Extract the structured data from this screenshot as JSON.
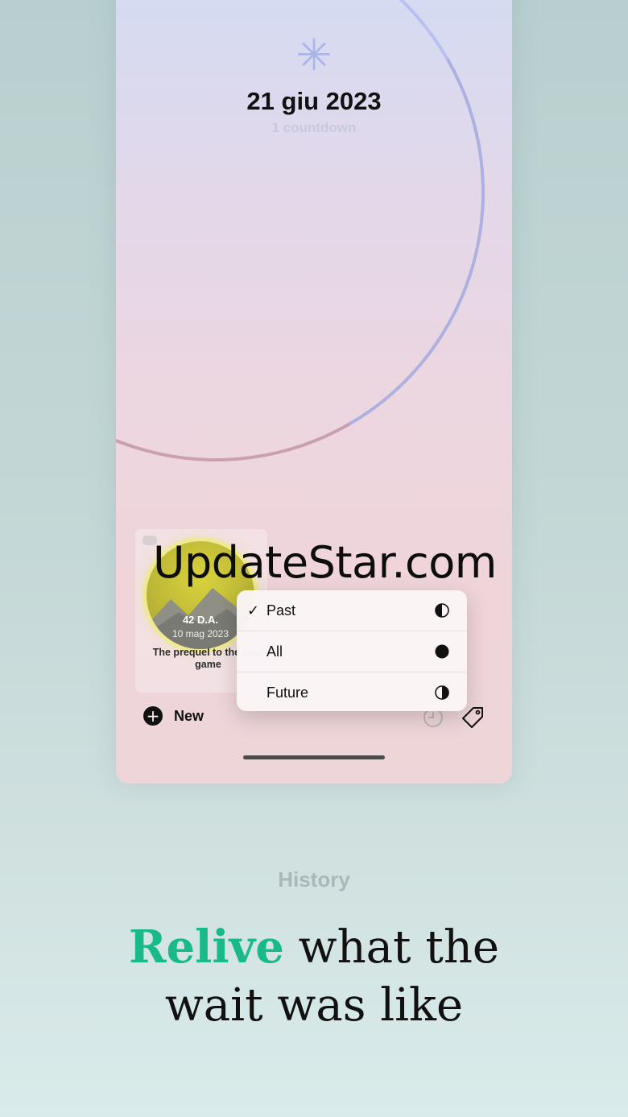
{
  "header": {
    "date_title": "21 giu 2023",
    "subtitle": "1 countdown"
  },
  "card": {
    "days": "42 D.A.",
    "date": "10 mag 2023",
    "title": "The prequel to the cool game"
  },
  "watermark": "UpdateStar.com",
  "filter_menu": {
    "items": [
      {
        "label": "Past",
        "checked": true,
        "icon": "half-circle-left-icon"
      },
      {
        "label": "All",
        "checked": false,
        "icon": "filled-circle-icon"
      },
      {
        "label": "Future",
        "checked": false,
        "icon": "half-circle-right-icon"
      }
    ]
  },
  "toolbar": {
    "new_label": "New",
    "icons": [
      "plus-circle-icon",
      "clock-icon",
      "tag-icon"
    ]
  },
  "promo": {
    "section": "History",
    "headline_accent": "Relive",
    "headline_line1_rest": " what the",
    "headline_line2": "wait was like"
  },
  "colors": {
    "accent": "#19b98a",
    "badge": "#cfc83a"
  }
}
